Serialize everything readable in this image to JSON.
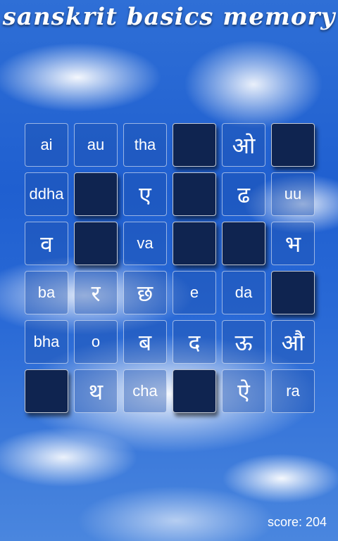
{
  "app": {
    "title": "sanskrit basics memory"
  },
  "board": {
    "tiles": [
      {
        "label": "ai",
        "state": "open",
        "script": "latin"
      },
      {
        "label": "au",
        "state": "open",
        "script": "latin"
      },
      {
        "label": "tha",
        "state": "open",
        "script": "latin"
      },
      {
        "label": "",
        "state": "hidden",
        "script": ""
      },
      {
        "label": "ओ",
        "state": "open",
        "script": "devanagari"
      },
      {
        "label": "",
        "state": "hidden",
        "script": ""
      },
      {
        "label": "ddha",
        "state": "open",
        "script": "latin"
      },
      {
        "label": "",
        "state": "hidden",
        "script": ""
      },
      {
        "label": "ए",
        "state": "open",
        "script": "devanagari"
      },
      {
        "label": "",
        "state": "hidden",
        "script": ""
      },
      {
        "label": "ढ",
        "state": "open",
        "script": "devanagari"
      },
      {
        "label": "uu",
        "state": "open",
        "script": "latin"
      },
      {
        "label": "व",
        "state": "open",
        "script": "devanagari"
      },
      {
        "label": "",
        "state": "hidden",
        "script": ""
      },
      {
        "label": "va",
        "state": "open",
        "script": "latin"
      },
      {
        "label": "",
        "state": "hidden",
        "script": ""
      },
      {
        "label": "",
        "state": "hidden",
        "script": ""
      },
      {
        "label": "भ",
        "state": "open",
        "script": "devanagari"
      },
      {
        "label": "ba",
        "state": "open",
        "script": "latin"
      },
      {
        "label": "र",
        "state": "open",
        "script": "devanagari"
      },
      {
        "label": "छ",
        "state": "open",
        "script": "devanagari"
      },
      {
        "label": "e",
        "state": "open",
        "script": "latin"
      },
      {
        "label": "da",
        "state": "open",
        "script": "latin"
      },
      {
        "label": "",
        "state": "hidden",
        "script": ""
      },
      {
        "label": "bha",
        "state": "open",
        "script": "latin"
      },
      {
        "label": "o",
        "state": "open",
        "script": "latin"
      },
      {
        "label": "ब",
        "state": "open",
        "script": "devanagari"
      },
      {
        "label": "द",
        "state": "open",
        "script": "devanagari"
      },
      {
        "label": "ऊ",
        "state": "open",
        "script": "devanagari"
      },
      {
        "label": "औ",
        "state": "open",
        "script": "devanagari"
      },
      {
        "label": "",
        "state": "hidden",
        "script": ""
      },
      {
        "label": "थ",
        "state": "open",
        "script": "devanagari"
      },
      {
        "label": "cha",
        "state": "open",
        "script": "latin"
      },
      {
        "label": "",
        "state": "hidden",
        "script": ""
      },
      {
        "label": "ऐ",
        "state": "open",
        "script": "devanagari"
      },
      {
        "label": "ra",
        "state": "open",
        "script": "latin"
      }
    ]
  },
  "score": {
    "text": "score: 204"
  }
}
